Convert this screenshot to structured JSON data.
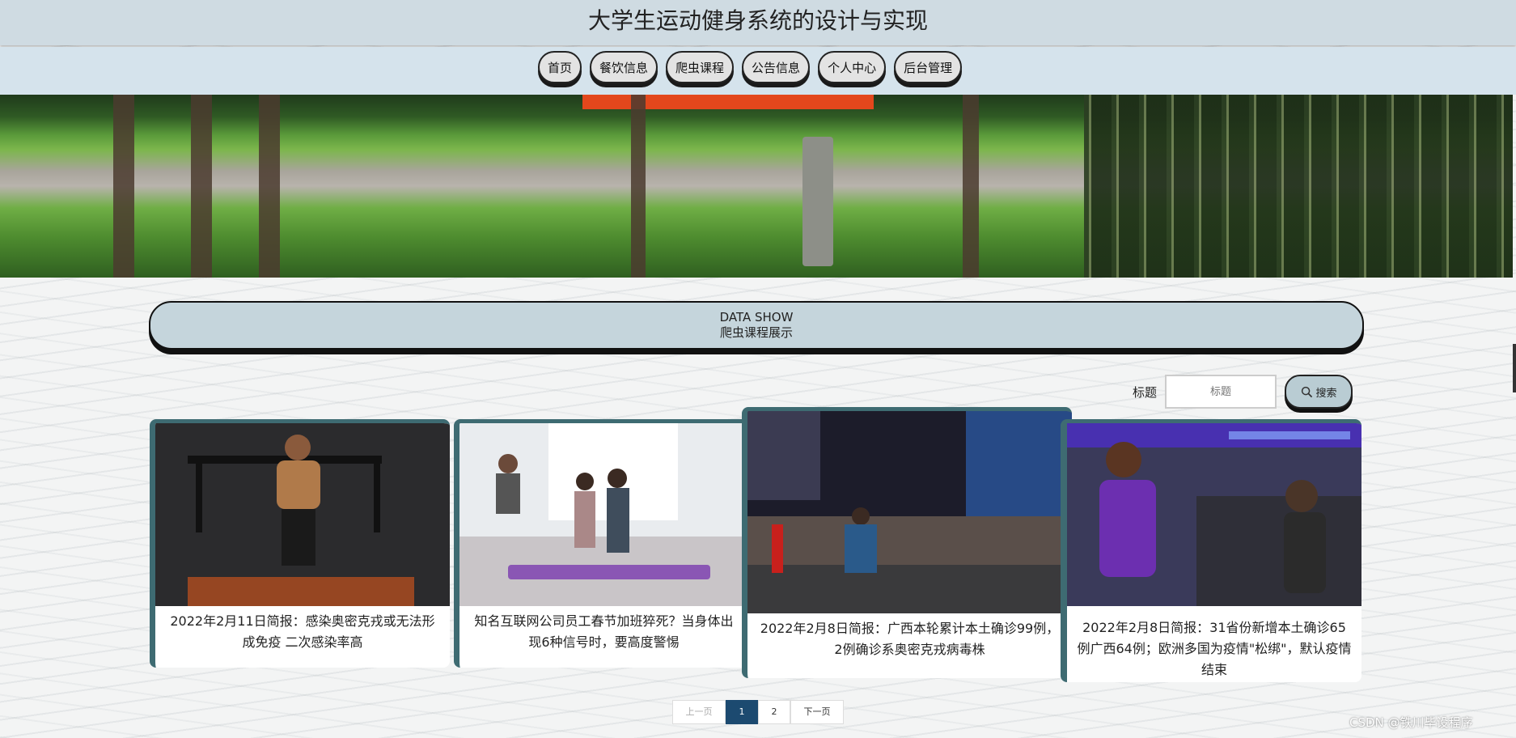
{
  "site": {
    "title": "大学生运动健身系统的设计与实现"
  },
  "nav": {
    "items": [
      {
        "label": "首页"
      },
      {
        "label": "餐饮信息"
      },
      {
        "label": "爬虫课程"
      },
      {
        "label": "公告信息"
      },
      {
        "label": "个人中心"
      },
      {
        "label": "后台管理"
      }
    ]
  },
  "section": {
    "title_en": "DATA SHOW",
    "title_cn": "爬虫课程展示"
  },
  "search": {
    "label": "标题",
    "placeholder": "标题",
    "button_label": "搜索"
  },
  "cards": [
    {
      "caption": "2022年2月11日简报：感染奥密克戎或无法形成免疫 二次感染率高"
    },
    {
      "caption": "知名互联网公司员工春节加班猝死？当身体出现6种信号时，要高度警惕"
    },
    {
      "caption": "2022年2月8日简报：广西本轮累计本土确诊99例，2例确诊系奥密克戎病毒株"
    },
    {
      "caption": "2022年2月8日简报：31省份新增本土确诊65例广西64例；欧洲多国为疫情\"松绑\"，默认疫情结束"
    }
  ],
  "pagination": {
    "prev": "上一页",
    "pages": [
      "1",
      "2"
    ],
    "current": "1",
    "next": "下一页"
  },
  "watermark": "CSDN @铁川毕设程序",
  "colors": {
    "accent": "#3e6b72",
    "page_active": "#1c4a70",
    "header_bg": "#c5d5dc"
  }
}
